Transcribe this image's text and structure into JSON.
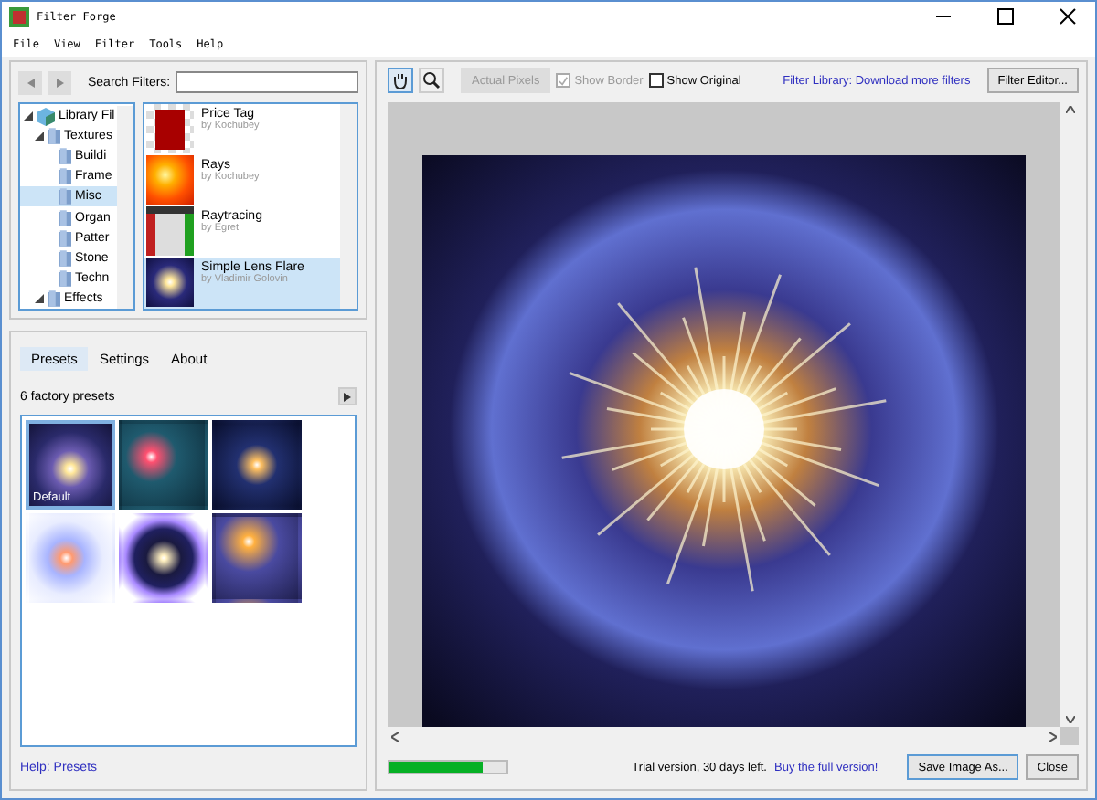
{
  "window": {
    "title": "Filter Forge"
  },
  "menu": [
    "File",
    "View",
    "Filter",
    "Tools",
    "Help"
  ],
  "search": {
    "label": "Search Filters:"
  },
  "tree": [
    {
      "label": "Library Fil",
      "expanded": true,
      "selected": false,
      "kind": "library",
      "children": [
        {
          "label": "Textures",
          "expanded": true,
          "selected": false,
          "kind": "folder",
          "children": [
            {
              "label": "Buildi",
              "selected": false,
              "kind": "folder"
            },
            {
              "label": "Frame",
              "selected": false,
              "kind": "folder"
            },
            {
              "label": "Misc",
              "selected": true,
              "kind": "folder"
            },
            {
              "label": "Organ",
              "selected": false,
              "kind": "folder"
            },
            {
              "label": "Patter",
              "selected": false,
              "kind": "folder"
            },
            {
              "label": "Stone",
              "selected": false,
              "kind": "folder"
            },
            {
              "label": "Techn",
              "selected": false,
              "kind": "folder"
            }
          ]
        },
        {
          "label": "Effects",
          "expanded": true,
          "selected": false,
          "kind": "folder"
        }
      ]
    }
  ],
  "filters": [
    {
      "name": "Price Tag",
      "author": "by Kochubey",
      "selected": false,
      "kind": "tag"
    },
    {
      "name": "Rays",
      "author": "by Kochubey",
      "selected": false,
      "kind": "rays"
    },
    {
      "name": "Raytracing",
      "author": "by Egret",
      "selected": false,
      "kind": "room"
    },
    {
      "name": "Simple Lens Flare",
      "author": "by Vladimir Golovin",
      "selected": true,
      "kind": "flare"
    }
  ],
  "tabs": [
    {
      "label": "Presets",
      "selected": true
    },
    {
      "label": "Settings",
      "selected": false
    },
    {
      "label": "About",
      "selected": false
    }
  ],
  "presets_count": "6 factory presets",
  "presets": [
    {
      "label": "Default",
      "selected": true
    },
    {
      "selected": false
    },
    {
      "selected": false
    },
    {
      "selected": false
    },
    {
      "selected": false
    },
    {
      "selected": false
    }
  ],
  "help_link": "Help: Presets",
  "toolbar": {
    "actual_pixels": {
      "label": "Actual Pixels",
      "disabled": true
    },
    "show_border": {
      "label": "Show Border",
      "checked": true,
      "disabled": true
    },
    "show_original": {
      "label": "Show Original",
      "checked": false,
      "disabled": false
    },
    "library_link": "Filter Library: Download more filters",
    "editor_button": "Filter Editor..."
  },
  "status": {
    "level": 0.8,
    "trial_text": "Trial version, 30 days left.",
    "buy_link": "Buy the full version!",
    "save_button": "Save Image As...",
    "close_button": "Close"
  }
}
